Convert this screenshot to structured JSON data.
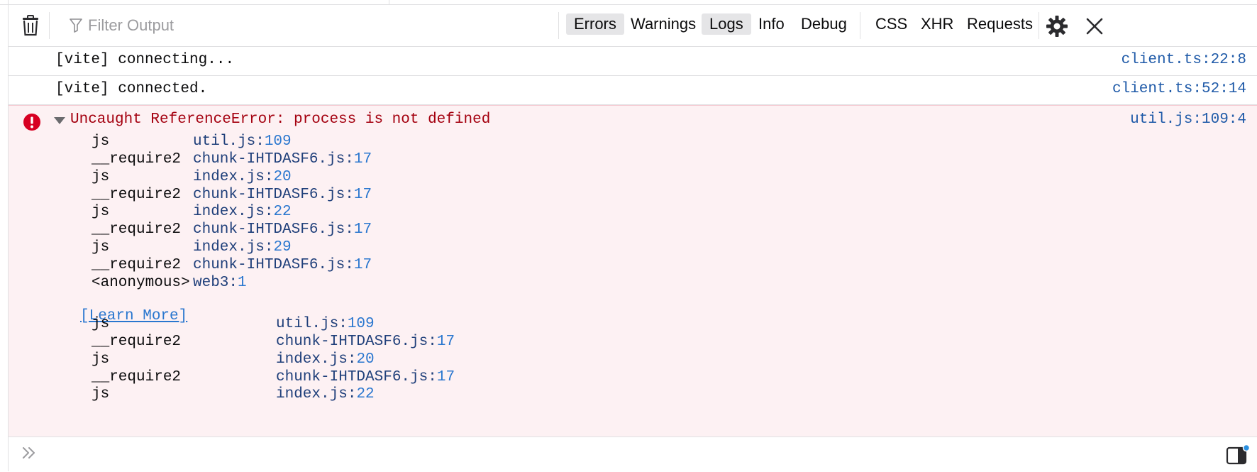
{
  "toolbar": {
    "filter_placeholder": "Filter Output",
    "levels": [
      {
        "label": "Errors",
        "active": true
      },
      {
        "label": "Warnings",
        "active": false
      },
      {
        "label": "Logs",
        "active": true
      },
      {
        "label": "Info",
        "active": false
      },
      {
        "label": "Debug",
        "active": false
      }
    ],
    "network": [
      "CSS",
      "XHR",
      "Requests"
    ],
    "icons": [
      "trash-icon",
      "filter-icon",
      "gear-icon",
      "close-icon"
    ]
  },
  "messages": [
    {
      "text": "[vite] connecting...",
      "location": "client.ts:22:8"
    },
    {
      "text": "[vite] connected.",
      "location": "client.ts:52:14"
    }
  ],
  "error": {
    "message": "Uncaught ReferenceError: process is not defined",
    "location": "util.js:109:4",
    "stack": [
      {
        "fn": "js",
        "file": "util.js",
        "line": "109"
      },
      {
        "fn": "__require2",
        "file": "chunk-IHTDASF6.js",
        "line": "17"
      },
      {
        "fn": "js",
        "file": "index.js",
        "line": "20"
      },
      {
        "fn": "__require2",
        "file": "chunk-IHTDASF6.js",
        "line": "17"
      },
      {
        "fn": "js",
        "file": "index.js",
        "line": "22"
      },
      {
        "fn": "__require2",
        "file": "chunk-IHTDASF6.js",
        "line": "17"
      },
      {
        "fn": "js",
        "file": "index.js",
        "line": "29"
      },
      {
        "fn": "__require2",
        "file": "chunk-IHTDASF6.js",
        "line": "17"
      },
      {
        "fn": "<anonymous>",
        "file": "web3",
        "line": "1"
      }
    ],
    "learn_more": "[Learn More]",
    "stack2": [
      {
        "fn": "js",
        "file": "util.js",
        "line": "109"
      },
      {
        "fn": "__require2",
        "file": "chunk-IHTDASF6.js",
        "line": "17"
      },
      {
        "fn": "js",
        "file": "index.js",
        "line": "20"
      },
      {
        "fn": "__require2",
        "file": "chunk-IHTDASF6.js",
        "line": "17"
      },
      {
        "fn": "js",
        "file": "index.js",
        "line": "22"
      }
    ]
  },
  "colors": {
    "error_bg": "#fdf1f3",
    "error_text": "#a4000f",
    "link": "#1f5aa8",
    "line_number": "#2a77cf",
    "active_filter_bg": "#e5e5e7"
  }
}
